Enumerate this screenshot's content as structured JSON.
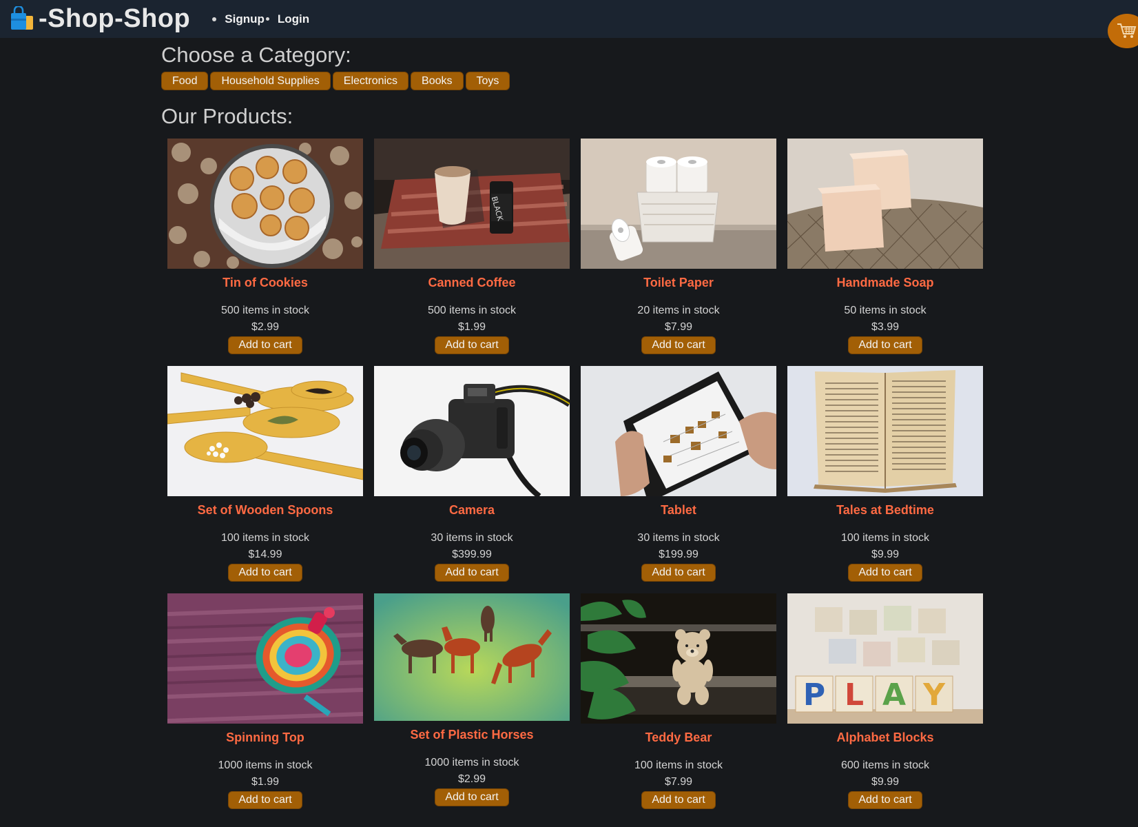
{
  "header": {
    "title": "-Shop-Shop",
    "nav": [
      {
        "label": "Signup"
      },
      {
        "label": "Login"
      }
    ]
  },
  "categories": {
    "heading": "Choose a Category:",
    "items": [
      "Food",
      "Household Supplies",
      "Electronics",
      "Books",
      "Toys"
    ]
  },
  "products": {
    "heading": "Our Products:",
    "add_label": "Add to cart",
    "items": [
      {
        "name": "Tin of Cookies",
        "stock": "500 items in stock",
        "price": "$2.99"
      },
      {
        "name": "Canned Coffee",
        "stock": "500 items in stock",
        "price": "$1.99"
      },
      {
        "name": "Toilet Paper",
        "stock": "20 items in stock",
        "price": "$7.99"
      },
      {
        "name": "Handmade Soap",
        "stock": "50 items in stock",
        "price": "$3.99"
      },
      {
        "name": "Set of Wooden Spoons",
        "stock": "100 items in stock",
        "price": "$14.99"
      },
      {
        "name": "Camera",
        "stock": "30 items in stock",
        "price": "$399.99"
      },
      {
        "name": "Tablet",
        "stock": "30 items in stock",
        "price": "$199.99"
      },
      {
        "name": "Tales at Bedtime",
        "stock": "100 items in stock",
        "price": "$9.99"
      },
      {
        "name": "Spinning Top",
        "stock": "1000 items in stock",
        "price": "$1.99"
      },
      {
        "name": "Set of Plastic Horses",
        "stock": "1000 items in stock",
        "price": "$2.99"
      },
      {
        "name": "Teddy Bear",
        "stock": "100 items in stock",
        "price": "$7.99"
      },
      {
        "name": "Alphabet Blocks",
        "stock": "600 items in stock",
        "price": "$9.99"
      }
    ]
  },
  "icons": {
    "brand": "shopping-bag-icon",
    "cart": "shopping-cart-icon"
  },
  "colors": {
    "header_bg": "#1b2430",
    "page_bg": "#17191c",
    "accent": "#a25f06",
    "product_name": "#ff6a43"
  }
}
